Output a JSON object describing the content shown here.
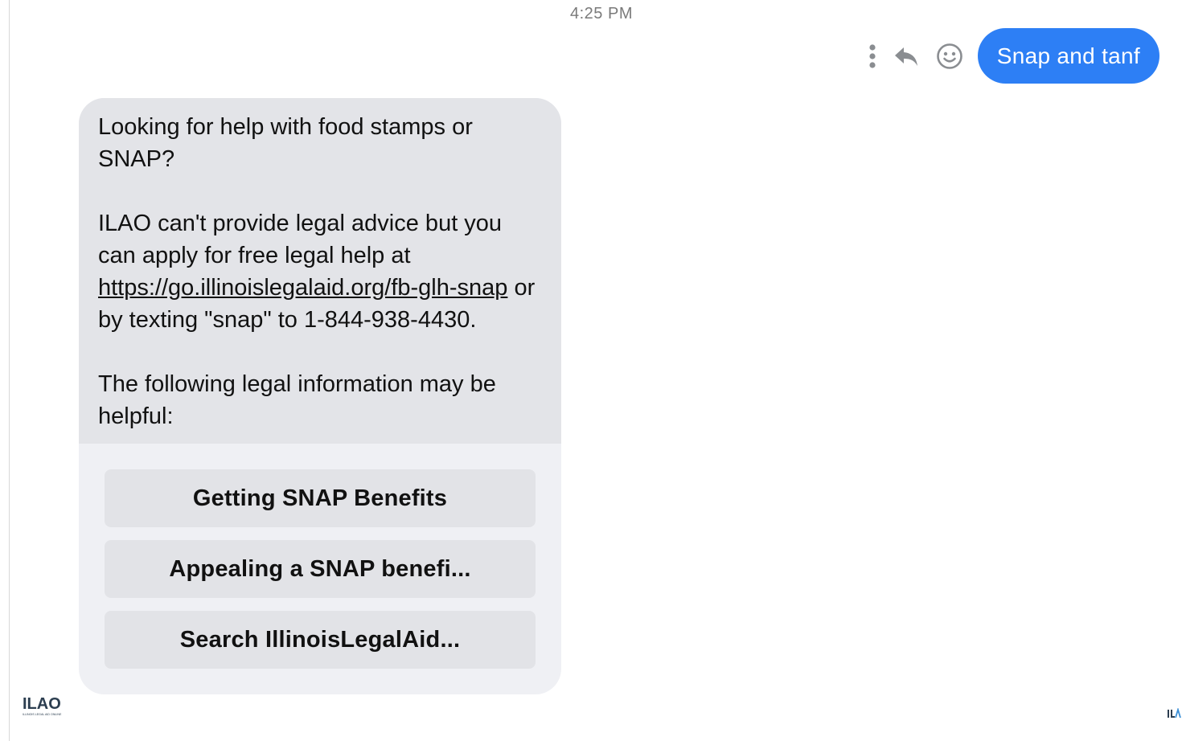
{
  "timestamp": "4:25 PM",
  "outgoing_message": {
    "text": "Snap and tanf"
  },
  "message_actions": {
    "more_icon": "more-vertical-icon",
    "reply_icon": "reply-icon",
    "react_icon": "smiley-icon"
  },
  "incoming_message": {
    "paragraph_1": "Looking for help with food stamps or SNAP?",
    "paragraph_2_before_link": "ILAO can't provide legal advice but you can apply for free legal help at ",
    "link_text": "https://go.illinoislegalaid.org/fb-glh-snap",
    "paragraph_2_after_link": " or by texting \"snap\" to 1-844-938-4430.",
    "paragraph_3": "The following legal information may be helpful:"
  },
  "quick_replies": [
    {
      "label": "Getting SNAP Benefits"
    },
    {
      "label": "Appealing a SNAP benefi..."
    },
    {
      "label": "Search IllinoisLegalAid..."
    }
  ],
  "avatar": {
    "logo_text": "ILAO",
    "logo_subtext": "ILLINOIS LEGAL AID ONLINE"
  },
  "colors": {
    "outgoing_bubble": "#2d7ff5",
    "incoming_bubble": "#e3e4e8",
    "quick_reply_bg": "#e2e3e7",
    "accent_blue": "#2d7ff5"
  }
}
